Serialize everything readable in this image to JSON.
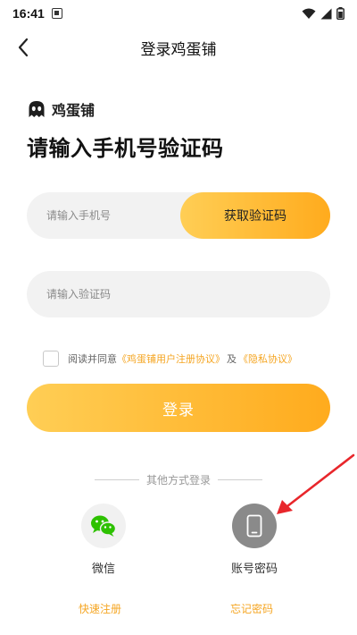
{
  "status_bar": {
    "time": "16:41"
  },
  "nav": {
    "title": "登录鸡蛋铺"
  },
  "brand": {
    "name": "鸡蛋铺"
  },
  "heading": "请输入手机号验证码",
  "phone": {
    "value": "",
    "placeholder": "请输入手机号",
    "get_code_label": "获取验证码"
  },
  "code": {
    "value": "",
    "placeholder": "请输入验证码"
  },
  "agreement": {
    "checked": false,
    "prefix": "阅读并同意",
    "user_agreement": "《鸡蛋铺用户注册协议》",
    "conjunction": "及",
    "privacy": "《隐私协议》"
  },
  "login_label": "登录",
  "other_methods": {
    "title": "其他方式登录",
    "wechat_label": "微信",
    "account_label": "账号密码"
  },
  "links": {
    "register": "快速注册",
    "forgot": "忘记密码"
  },
  "colors": {
    "accent_start": "#ffce55",
    "accent_end": "#ffab1d",
    "link": "#f5a623",
    "wechat_green": "#2dc100",
    "annotation_red": "#e8262b"
  }
}
